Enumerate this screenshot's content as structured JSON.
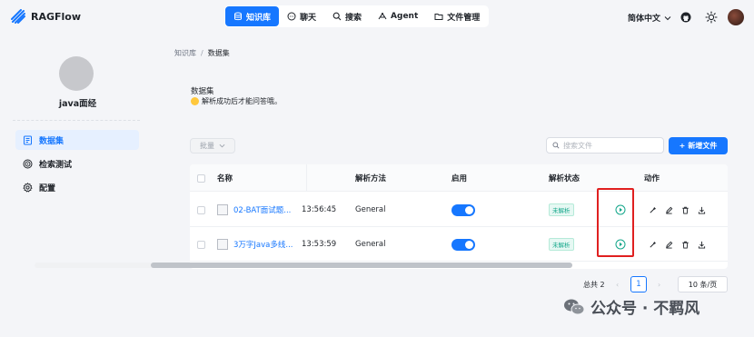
{
  "app": {
    "name": "RAGFlow"
  },
  "nav": [
    {
      "label": "知识库",
      "icon": "database-icon",
      "active": true
    },
    {
      "label": "聊天",
      "icon": "chat-icon",
      "active": false
    },
    {
      "label": "搜索",
      "icon": "search-icon",
      "active": false
    },
    {
      "label": "Agent",
      "icon": "agent-icon",
      "active": false
    },
    {
      "label": "文件管理",
      "icon": "folder-icon",
      "active": false
    }
  ],
  "header": {
    "language": "简体中文"
  },
  "sidebar": {
    "kb_name": "java面经",
    "items": [
      {
        "label": "数据集",
        "icon": "document-icon",
        "active": true
      },
      {
        "label": "检索测试",
        "icon": "target-icon",
        "active": false
      },
      {
        "label": "配置",
        "icon": "gear-icon",
        "active": false
      }
    ]
  },
  "breadcrumb": {
    "root": "知识库",
    "separator": "/",
    "current": "数据集"
  },
  "section": {
    "title": "数据集",
    "tip": "解析成功后才能问答哦。"
  },
  "toolbar": {
    "batch_label": "批量",
    "search_placeholder": "搜索文件",
    "add_label": "新增文件"
  },
  "table": {
    "columns": {
      "name": "名称",
      "method": "解析方法",
      "enabled": "启用",
      "status": "解析状态",
      "action": "动作"
    },
    "rows": [
      {
        "name": "02-BAT面试题...",
        "time": "13:56:45",
        "method": "General",
        "enabled": true,
        "status": "未解析"
      },
      {
        "name": "3万字Java多线...",
        "time": "13:53:59",
        "method": "General",
        "enabled": true,
        "status": "未解析"
      }
    ]
  },
  "pagination": {
    "total": "总共 2",
    "current": "1",
    "page_size": "10 条/页"
  },
  "watermark": {
    "text": "公众号 · 不羁风"
  },
  "colors": {
    "accent": "#1677ff",
    "highlight_box": "#e02020",
    "status_badge": "#13a68a"
  }
}
